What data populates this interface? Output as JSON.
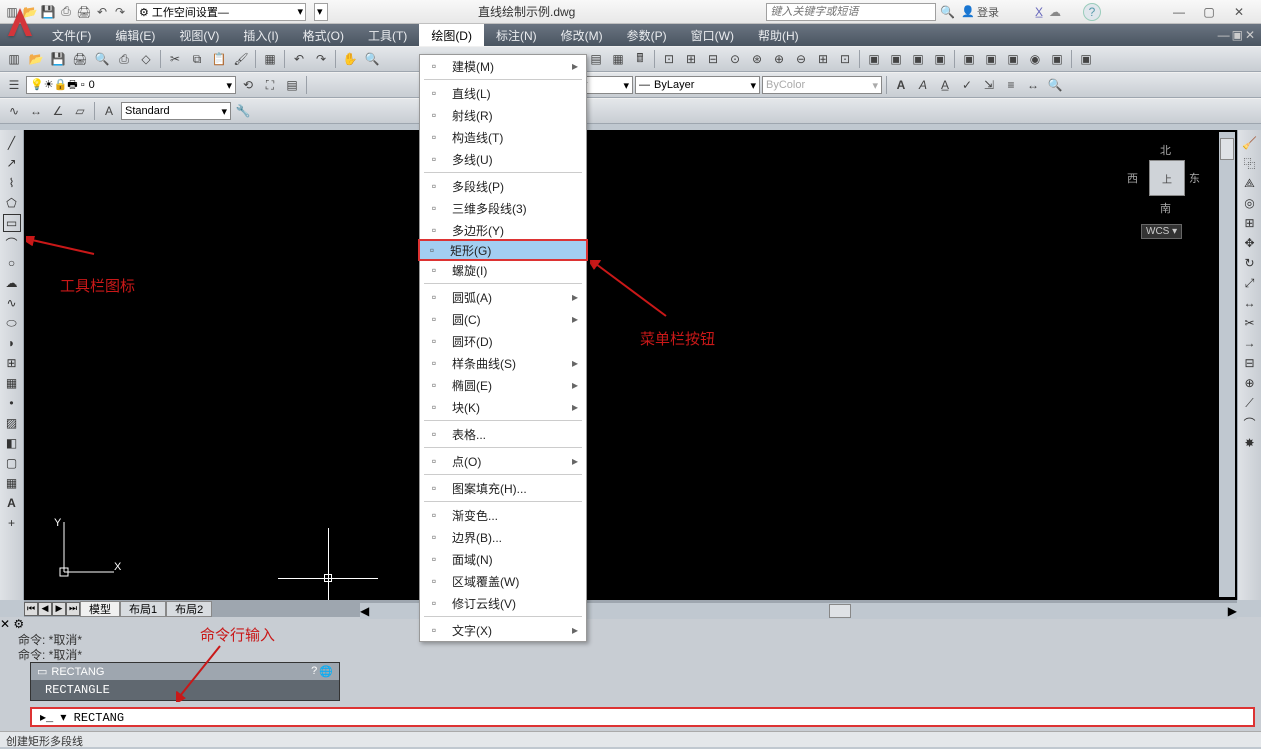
{
  "title": {
    "workspace": "⚙ 工作空间设置—",
    "document": "直线绘制示例.dwg",
    "search_placeholder": "键入关键字或短语",
    "login": "登录"
  },
  "menubar": [
    "文件(F)",
    "编辑(E)",
    "视图(V)",
    "插入(I)",
    "格式(O)",
    "工具(T)",
    "绘图(D)",
    "标注(N)",
    "修改(M)",
    "参数(P)",
    "窗口(W)",
    "帮助(H)"
  ],
  "layer": {
    "current": "0",
    "linetype": "ByLayer",
    "lineweight": "ByLayer",
    "plotstyle": "ByColor",
    "textstyle": "Standard"
  },
  "draw_menu": [
    {
      "label": "建模(M)",
      "sub": true,
      "sep_after": true
    },
    {
      "label": "直线(L)"
    },
    {
      "label": "射线(R)"
    },
    {
      "label": "构造线(T)"
    },
    {
      "label": "多线(U)",
      "sep_after": true
    },
    {
      "label": "多段线(P)"
    },
    {
      "label": "三维多段线(3)"
    },
    {
      "label": "多边形(Y)"
    },
    {
      "label": "矩形(G)",
      "hl": true
    },
    {
      "label": "螺旋(I)",
      "sep_after": true
    },
    {
      "label": "圆弧(A)",
      "sub": true
    },
    {
      "label": "圆(C)",
      "sub": true
    },
    {
      "label": "圆环(D)"
    },
    {
      "label": "样条曲线(S)",
      "sub": true
    },
    {
      "label": "椭圆(E)",
      "sub": true
    },
    {
      "label": "块(K)",
      "sub": true,
      "sep_after": true
    },
    {
      "label": "表格...",
      "sep_after": true
    },
    {
      "label": "点(O)",
      "sub": true,
      "sep_after": true
    },
    {
      "label": "图案填充(H)...",
      "sep_after": true
    },
    {
      "label": "渐变色..."
    },
    {
      "label": "边界(B)..."
    },
    {
      "label": "面域(N)"
    },
    {
      "label": "区域覆盖(W)"
    },
    {
      "label": "修订云线(V)",
      "sep_after": true
    },
    {
      "label": "文字(X)",
      "sub": true
    }
  ],
  "tabs": {
    "model": "模型",
    "layout1": "布局1",
    "layout2": "布局2"
  },
  "viewcube": {
    "n": "北",
    "s": "南",
    "e": "东",
    "w": "西",
    "top": "上",
    "wcs": "WCS ▾"
  },
  "annotations": {
    "toolbar_icon": "工具栏图标",
    "menu_button": "菜单栏按钮",
    "cmd_input": "命令行输入"
  },
  "command": {
    "hist1": "命令:  *取消*",
    "hist2": "命令:  *取消*",
    "ac_head": "RECTANG",
    "ac_item": "RECTANGLE",
    "prompt": "▸_ ▾ RECTANG"
  },
  "status": "创建矩形多段线"
}
